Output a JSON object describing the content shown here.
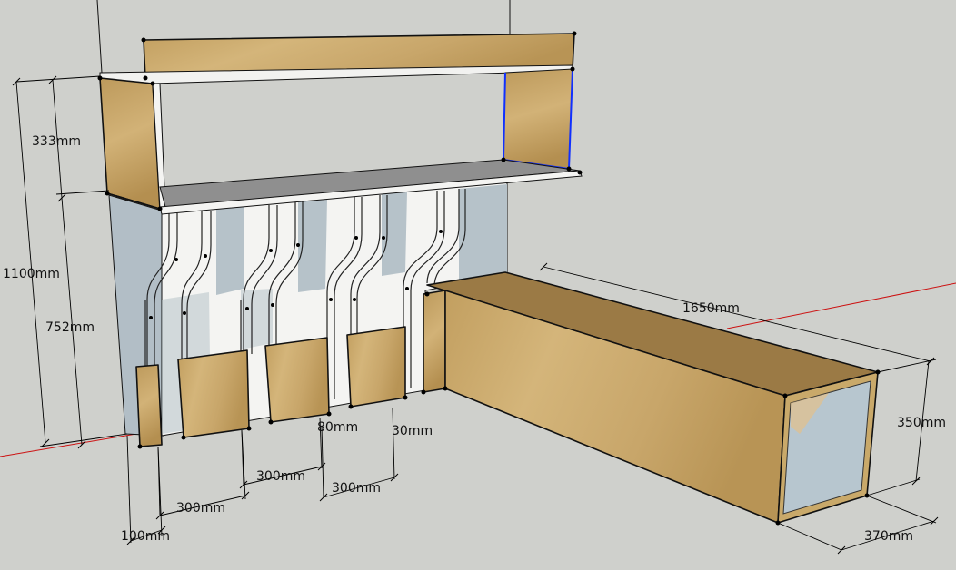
{
  "colors": {
    "background": "#cfd0cc",
    "wood": "#c9a96a",
    "wood_dark": "#b08a4e",
    "wall": "#b6c2c9",
    "shelf": "#8f8f8f",
    "white_panel": "#f4f4f2",
    "selection_edge": "#1030ff",
    "axis_red": "#cc1111"
  },
  "dimensions": {
    "total_height": "1100mm",
    "upper_height": "333mm",
    "lower_height": "752mm",
    "bench_length": "1650mm",
    "bench_height": "350mm",
    "bench_depth": "370mm",
    "panel_width_1": "300mm",
    "panel_width_2": "300mm",
    "panel_width_3": "300mm",
    "gap_1": "80mm",
    "gap_2": "30mm",
    "post_width": "100mm"
  }
}
